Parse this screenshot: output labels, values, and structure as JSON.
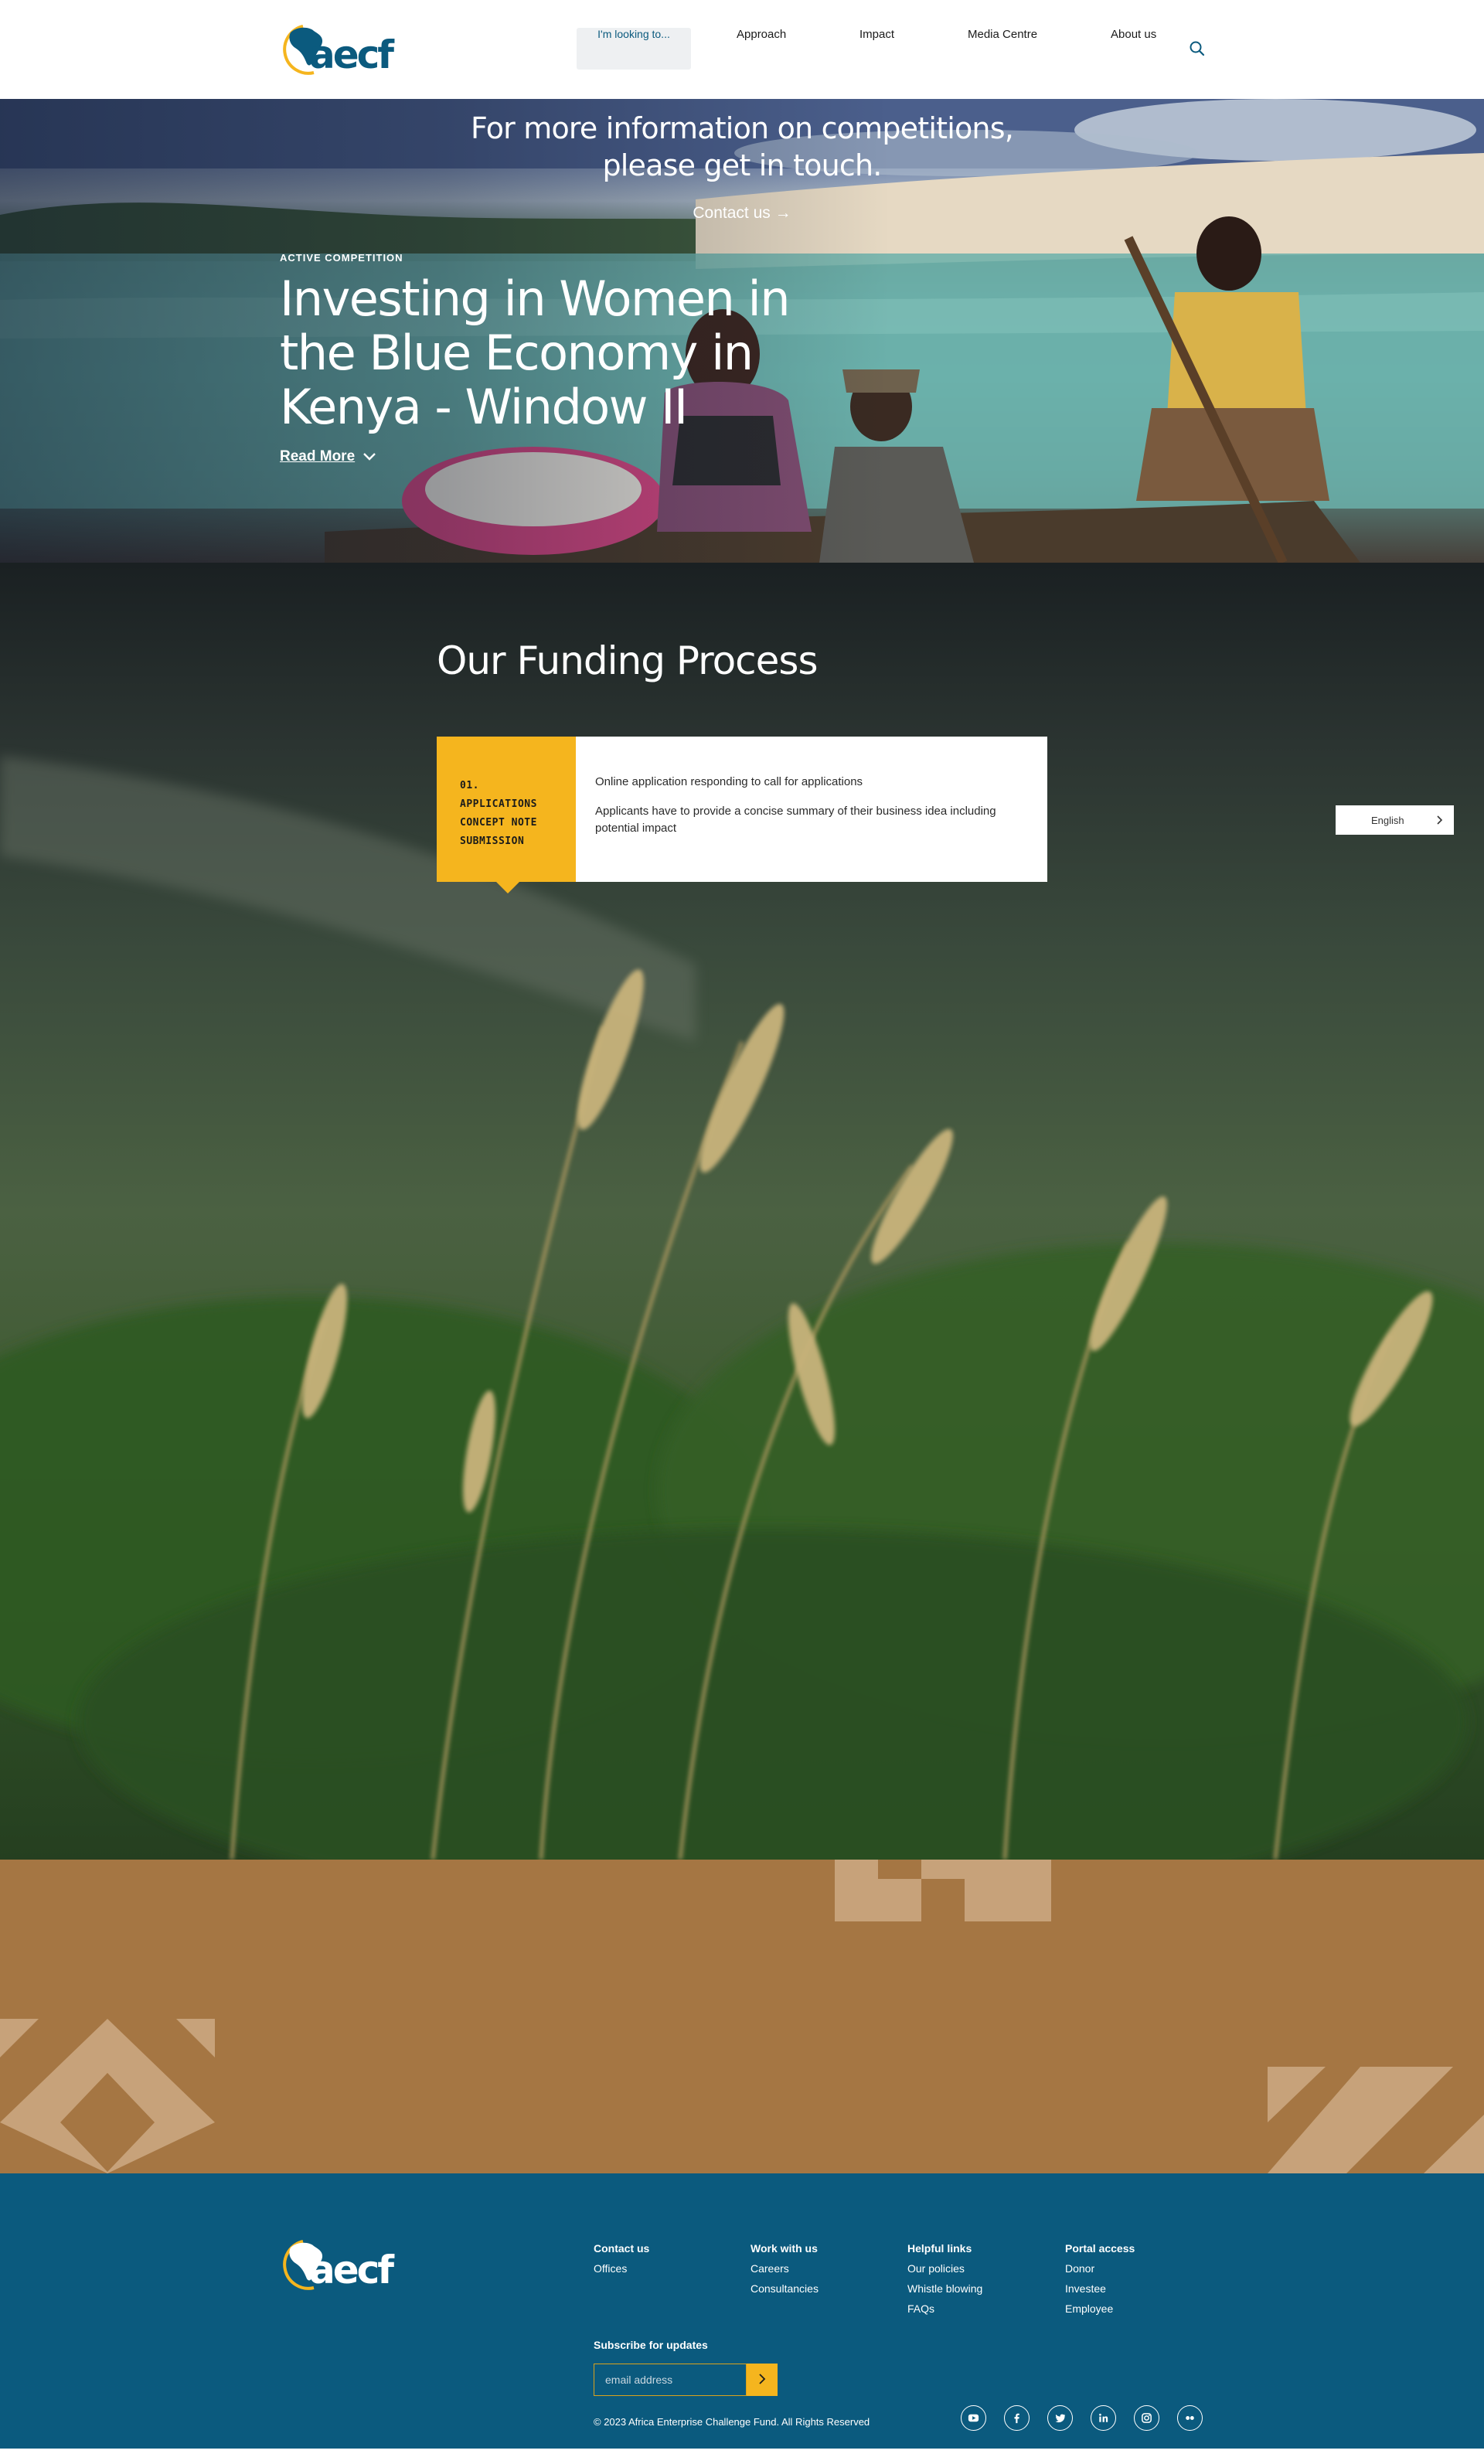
{
  "header": {
    "logo_text": "aecf",
    "nav": {
      "looking": "I'm looking to...",
      "approach": "Approach",
      "impact": "Impact",
      "media": "Media Centre",
      "about": "About us"
    }
  },
  "hero": {
    "kicker": "ACTIVE COMPETITION",
    "title": "Investing in Women in the Blue Economy in Kenya - Window II",
    "read_more": "Read More"
  },
  "funding": {
    "title": "Our Funding Process",
    "step": {
      "number": "01.",
      "name": "APPLICATIONS CONCEPT NOTE SUBMISSION",
      "line1": "Online application responding to call for applications",
      "line2": "Applicants have to provide a concise summary of their business idea including potential impact"
    },
    "language": "English"
  },
  "contact": {
    "text": "For more information on competitions, please get in touch.",
    "link": "Contact us →"
  },
  "footer": {
    "logo_text": "aecf",
    "col1": {
      "head": "Contact us",
      "items": [
        "Offices"
      ]
    },
    "col2": {
      "head": "Work with us",
      "items": [
        "Careers",
        "Consultancies"
      ]
    },
    "col3": {
      "head": "Helpful links",
      "items": [
        "Our policies",
        "Whistle blowing",
        "FAQs"
      ]
    },
    "col4": {
      "head": "Portal access",
      "items": [
        "Donor",
        "Investee",
        "Employee"
      ]
    },
    "subscribe_label": "Subscribe for updates",
    "email_placeholder": "email address",
    "copyright": "© 2023 Africa Enterprise Challenge Fund. All Rights Reserved",
    "socials": [
      "youtube-icon",
      "facebook-icon",
      "twitter-icon",
      "linkedin-icon",
      "instagram-icon",
      "flickr-icon"
    ]
  },
  "colors": {
    "brand_blue": "#0b5a7e",
    "accent_yellow": "#f5b51e",
    "contact_brown": "#a57643"
  }
}
